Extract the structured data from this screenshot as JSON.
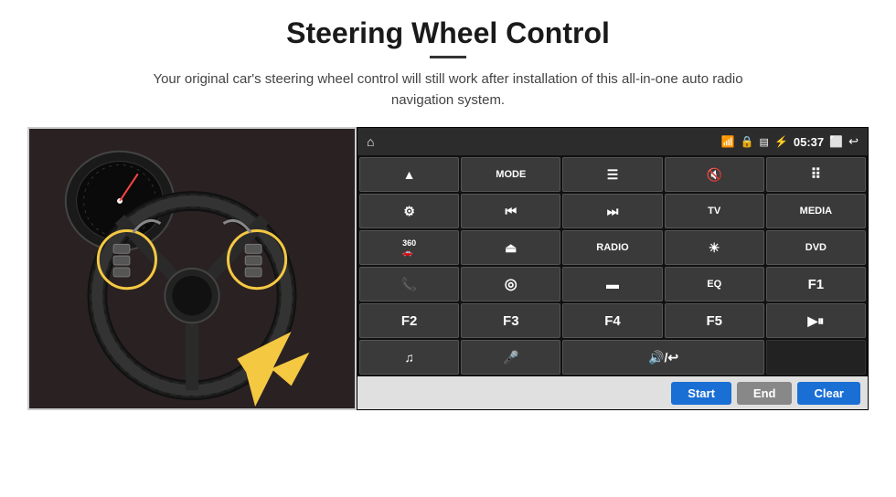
{
  "page": {
    "title": "Steering Wheel Control",
    "subtitle": "Your original car's steering wheel control will still work after installation of this all-in-one auto radio navigation system."
  },
  "status_bar": {
    "time": "05:37",
    "left_icon": "home",
    "right_icons": [
      "wifi",
      "lock",
      "sd",
      "bluetooth",
      "time",
      "cast",
      "back"
    ]
  },
  "button_rows": [
    [
      {
        "label": "⬆",
        "icon": true,
        "id": "nav-arrow"
      },
      {
        "label": "MODE",
        "icon": false,
        "id": "mode"
      },
      {
        "label": "☰",
        "icon": true,
        "id": "menu"
      },
      {
        "label": "🔇",
        "icon": true,
        "id": "mute"
      },
      {
        "label": "⠿",
        "icon": true,
        "id": "apps"
      }
    ],
    [
      {
        "label": "⚙",
        "icon": true,
        "id": "settings"
      },
      {
        "label": "⏮",
        "icon": true,
        "id": "prev"
      },
      {
        "label": "⏭",
        "icon": true,
        "id": "next"
      },
      {
        "label": "TV",
        "icon": false,
        "id": "tv"
      },
      {
        "label": "MEDIA",
        "icon": false,
        "id": "media"
      }
    ],
    [
      {
        "label": "360",
        "icon": false,
        "id": "cam-360"
      },
      {
        "label": "▲",
        "icon": true,
        "id": "eject"
      },
      {
        "label": "RADIO",
        "icon": false,
        "id": "radio"
      },
      {
        "label": "☀",
        "icon": true,
        "id": "brightness"
      },
      {
        "label": "DVD",
        "icon": false,
        "id": "dvd"
      }
    ],
    [
      {
        "label": "📞",
        "icon": true,
        "id": "phone"
      },
      {
        "label": "🌐",
        "icon": true,
        "id": "nav"
      },
      {
        "label": "▬",
        "icon": true,
        "id": "screen"
      },
      {
        "label": "EQ",
        "icon": false,
        "id": "eq"
      },
      {
        "label": "F1",
        "icon": false,
        "id": "f1"
      }
    ],
    [
      {
        "label": "F2",
        "icon": false,
        "id": "f2"
      },
      {
        "label": "F3",
        "icon": false,
        "id": "f3"
      },
      {
        "label": "F4",
        "icon": false,
        "id": "f4"
      },
      {
        "label": "F5",
        "icon": false,
        "id": "f5"
      },
      {
        "label": "▶⏸",
        "icon": true,
        "id": "playpause"
      }
    ],
    [
      {
        "label": "♫",
        "icon": true,
        "id": "music"
      },
      {
        "label": "🎤",
        "icon": true,
        "id": "mic"
      },
      {
        "label": "🔊/↩",
        "icon": true,
        "id": "vol-back",
        "span": 2
      }
    ]
  ],
  "action_buttons": {
    "start": "Start",
    "end": "End",
    "clear": "Clear"
  }
}
